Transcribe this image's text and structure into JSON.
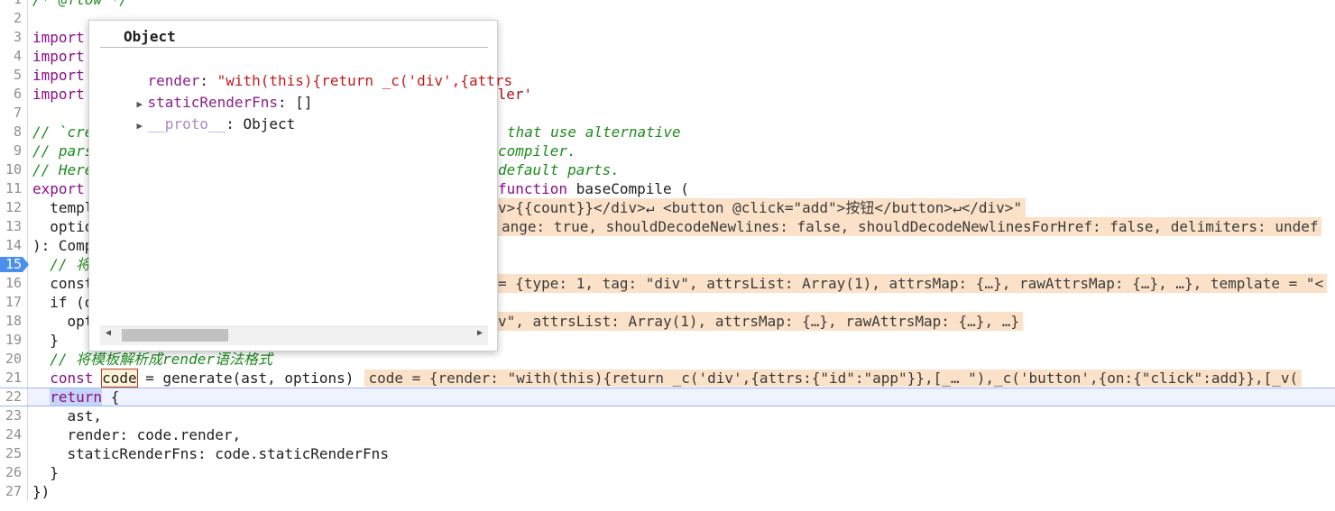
{
  "editor": {
    "lines": [
      {
        "n": "1",
        "text": "/* @flow */",
        "kind": "comment"
      },
      {
        "n": "2",
        "text": ""
      },
      {
        "n": "3",
        "text": "import",
        "kind": "kw"
      },
      {
        "n": "4",
        "text": "import",
        "kind": "kw"
      },
      {
        "n": "5",
        "text": "import",
        "kind": "kw"
      },
      {
        "n": "6",
        "text": "import",
        "kind": "kw",
        "tail": "iler'"
      },
      {
        "n": "7",
        "text": ""
      },
      {
        "n": "8",
        "text": "// `cre",
        "kind": "comment",
        "tail": "that use alternative"
      },
      {
        "n": "9",
        "text": "// pars",
        "kind": "comment",
        "tail": "compiler."
      },
      {
        "n": "10",
        "text": "// Here",
        "kind": "comment",
        "tail": "default parts."
      },
      {
        "n": "11",
        "text": "export",
        "kind": "kw",
        "tail": "function baseCompile ("
      },
      {
        "n": "12",
        "text": "  templ",
        "tail": "v>{{count}}</div>↵ <button @click=\"add\">按钮</button>↵</div>\""
      },
      {
        "n": "13",
        "text": "  optio",
        "tail": "ange: true, shouldDecodeNewlines: false, shouldDecodeNewlinesForHref: false, delimiters: undef"
      },
      {
        "n": "14",
        "text": "): Comp"
      },
      {
        "n": "15",
        "text": "  // 将",
        "kind": "comment"
      },
      {
        "n": "16",
        "text": "  const",
        "tail": "= {type: 1, tag: \"div\", attrsList: Array(1), attrsMap: {…}, rawAttrsMap: {…}, …}, template = \"<"
      },
      {
        "n": "17",
        "text": "  if (o"
      },
      {
        "n": "18",
        "text": "    opt",
        "tail": "v\", attrsList: Array(1), attrsMap: {…}, rawAttrsMap: {…}, …}"
      },
      {
        "n": "19",
        "text": "  }"
      },
      {
        "n": "20",
        "text": "  // 将模板解析成render语法格式",
        "kind": "comment"
      },
      {
        "n": "21",
        "text": "  const code = generate(ast, options)",
        "inline": "code = {render: \"with(this){return _c('div',{attrs:{\"id\":\"app\"}},[_… \"),_c('button',{on:{\"click\":add}},[_v("
      },
      {
        "n": "22",
        "text": "  return {"
      },
      {
        "n": "23",
        "text": "    ast,"
      },
      {
        "n": "24",
        "text": "    render: code.render,"
      },
      {
        "n": "25",
        "text": "    staticRenderFns: code.staticRenderFns"
      },
      {
        "n": "26",
        "text": "  }"
      },
      {
        "n": "27",
        "text": "})"
      }
    ],
    "line21": {
      "keyword": "const",
      "var": "code",
      "rest": " = generate(ast, options)"
    },
    "line22": {
      "keyword": "return",
      "rest": " {"
    }
  },
  "popover": {
    "title": "Object",
    "props": [
      {
        "key": "render",
        "sep": ": ",
        "value": "\"with(this){return _c('div',{attrs",
        "expandable": false
      },
      {
        "key": "staticRenderFns",
        "sep": ": ",
        "value": "[]",
        "expandable": true
      },
      {
        "key": "__proto__",
        "sep": ": ",
        "value": "Object",
        "expandable": true
      }
    ]
  },
  "colors": {
    "keyword": "#880f88",
    "comment": "#1f8a1f",
    "string": "#a31515",
    "inline_bg": "#fbe1c8",
    "breakpoint": "#4a8ef0"
  }
}
